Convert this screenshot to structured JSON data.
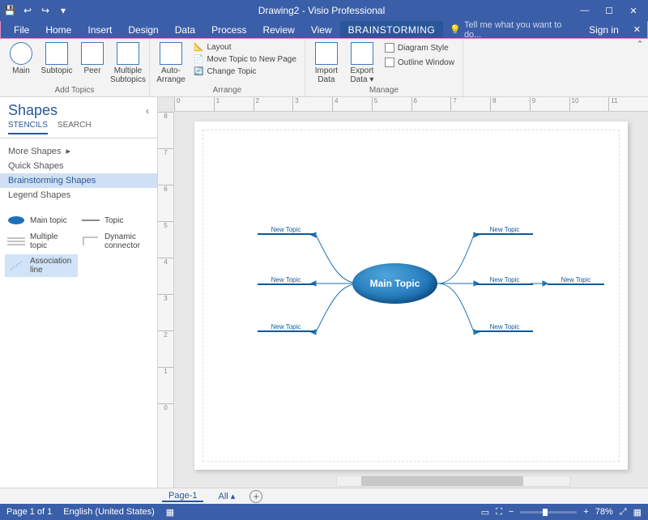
{
  "titlebar": {
    "doc_title": "Drawing2 - Visio Professional"
  },
  "menu": {
    "items": [
      "File",
      "Home",
      "Insert",
      "Design",
      "Data",
      "Process",
      "Review",
      "View"
    ],
    "context_tab": "BRAINSTORMING",
    "tellme_placeholder": "Tell me what you want to do...",
    "signin": "Sign in"
  },
  "ribbon": {
    "group_add_topics": {
      "label": "Add Topics",
      "main": "Main",
      "subtopic": "Subtopic",
      "peer": "Peer",
      "multiple": "Multiple\nSubtopics"
    },
    "group_arrange": {
      "label": "Arrange",
      "auto_arrange": "Auto-\nArrange",
      "layout": "Layout",
      "move_new_page": "Move Topic to New Page",
      "change_topic": "Change Topic"
    },
    "group_manage": {
      "label": "Manage",
      "import": "Import\nData",
      "export": "Export\nData ▾",
      "diagram_style": "Diagram Style",
      "outline_window": "Outline Window"
    }
  },
  "shapes_pane": {
    "title": "Shapes",
    "tabs": [
      "STENCILS",
      "SEARCH"
    ],
    "more_shapes": "More Shapes",
    "stencils": [
      "Quick Shapes",
      "Brainstorming Shapes",
      "Legend Shapes"
    ],
    "shapes": {
      "main_topic": "Main topic",
      "topic": "Topic",
      "multiple_topic": "Multiple topic",
      "dynamic_connector": "Dynamic connector",
      "association_line": "Association line"
    }
  },
  "canvas": {
    "main_topic_label": "Main Topic",
    "node_label": "New Topic",
    "ruler_h": [
      "0",
      "1",
      "2",
      "3",
      "4",
      "5",
      "6",
      "7",
      "8",
      "9",
      "10",
      "11"
    ],
    "ruler_v": [
      "8",
      "7",
      "6",
      "5",
      "4",
      "3",
      "2",
      "1",
      "0"
    ]
  },
  "pagetabs": {
    "page1": "Page-1",
    "all": "All"
  },
  "status": {
    "page": "Page 1 of 1",
    "lang": "English (United States)",
    "zoom": "78%"
  }
}
